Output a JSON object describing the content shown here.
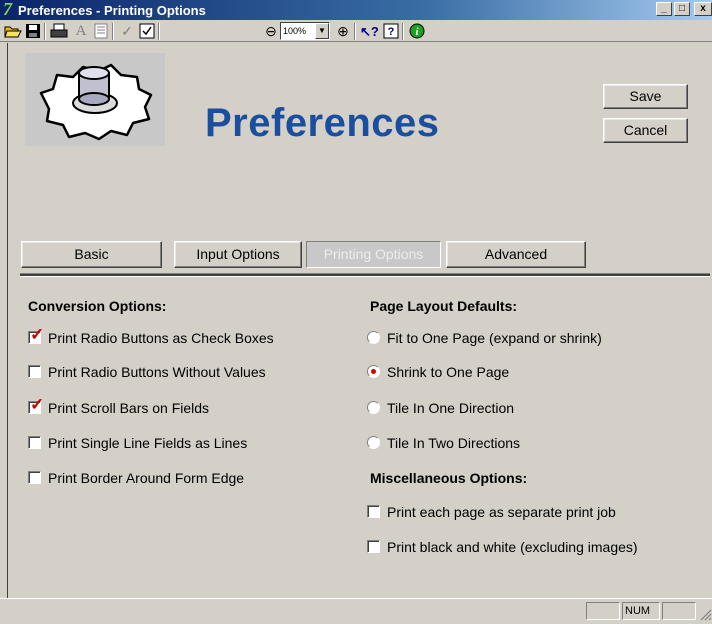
{
  "window": {
    "title": "Preferences - Printing Options",
    "app_icon_glyph": "7",
    "minimize": "_",
    "maximize": "□",
    "close": "x"
  },
  "toolbar": {
    "zoom_value": "100%",
    "icons": [
      "open-folder-icon",
      "save-icon",
      "print-icon",
      "font-icon",
      "form-icon",
      "spell-check-icon",
      "spell-form-icon",
      "zoom-out-icon",
      "zoom-in-icon",
      "whats-this-icon",
      "help-icon",
      "info-icon"
    ]
  },
  "header": {
    "title": "Preferences",
    "save_label": "Save",
    "cancel_label": "Cancel"
  },
  "tabs": [
    {
      "label": "Basic",
      "active": false
    },
    {
      "label": "Input Options",
      "active": false
    },
    {
      "label": "Printing Options",
      "active": true
    },
    {
      "label": "Advanced",
      "active": false
    }
  ],
  "conversion": {
    "title": "Conversion Options:",
    "options": [
      {
        "label": "Print Radio Buttons as Check Boxes",
        "checked": true
      },
      {
        "label": "Print Radio Buttons Without Values",
        "checked": false
      },
      {
        "label": "Print Scroll Bars on Fields",
        "checked": true
      },
      {
        "label": "Print Single Line Fields as Lines",
        "checked": false
      },
      {
        "label": "Print Border Around Form Edge",
        "checked": false
      }
    ]
  },
  "layout": {
    "title": "Page Layout Defaults:",
    "options": [
      {
        "label": "Fit to One Page (expand or shrink)",
        "selected": false
      },
      {
        "label": "Shrink to One Page",
        "selected": true
      },
      {
        "label": "Tile In One Direction",
        "selected": false
      },
      {
        "label": "Tile In Two Directions",
        "selected": false
      }
    ]
  },
  "misc": {
    "title": "Miscellaneous Options:",
    "options": [
      {
        "label": "Print each page as separate print job",
        "checked": false
      },
      {
        "label": "Print black and white (excluding images)",
        "checked": false
      }
    ]
  },
  "status": {
    "num": "NUM"
  },
  "colors": {
    "accent": "#1a4f9f",
    "check": "#d00000",
    "face": "#d4d0c8"
  }
}
